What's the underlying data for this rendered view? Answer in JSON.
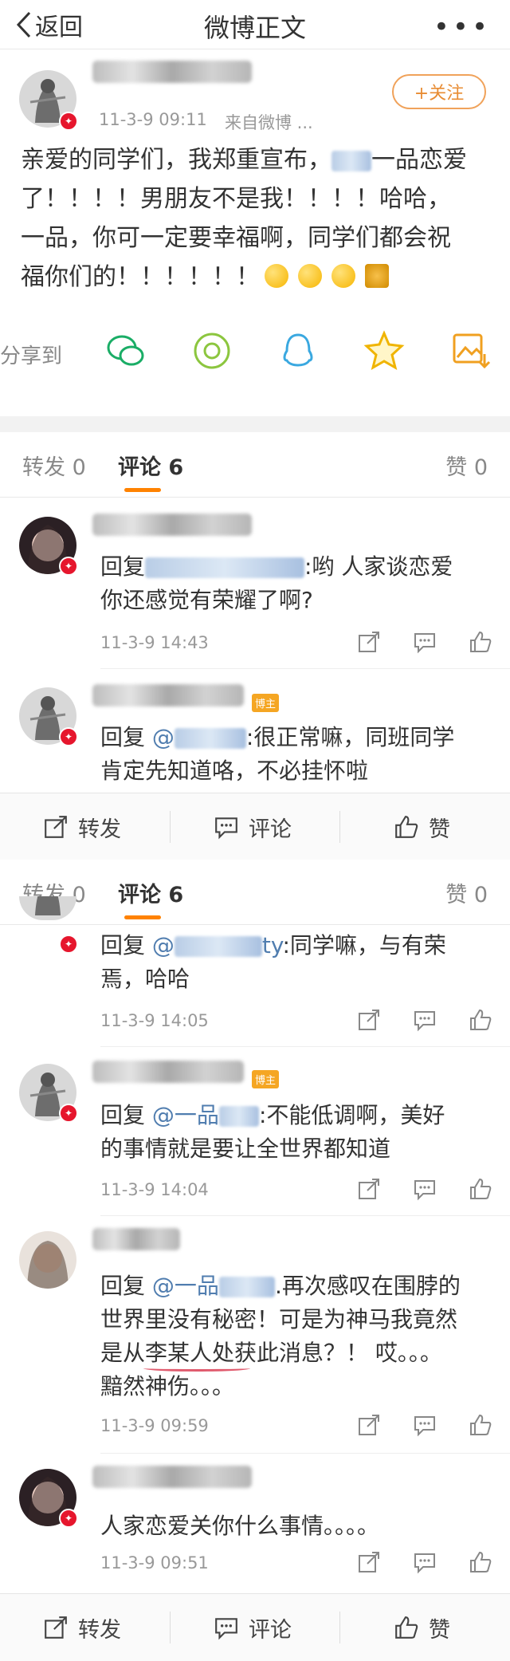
{
  "header": {
    "back_label": "返回",
    "title": "微博正文",
    "more": "•••"
  },
  "post": {
    "time": "11-3-9 09:11",
    "source": "来自微博 ...",
    "follow_label": "+关注",
    "text_lines": [
      "亲爱的同学们，我郑重宣布，",
      "一品恋爱",
      "了！！！！男朋友不是我！！！！哈哈，",
      "一品，你可一定要幸福啊，同学们都会祝",
      "福你们的！！！！！！"
    ]
  },
  "share": {
    "label": "分享到"
  },
  "tabs": {
    "repost": "转发 0",
    "comment": "评论 6",
    "like": "赞 0"
  },
  "actions": {
    "repost": "转发",
    "comment": "评论",
    "like": "赞"
  },
  "host_tag": "博主",
  "comments": [
    {
      "prefix": "回复",
      "text": ":哟 人家谈恋爱",
      "line2": "你还感觉有荣耀了啊?",
      "time": "11-3-9 14:43"
    },
    {
      "prefix": "回复",
      "mention": "@",
      "text": ":很正常嘛，同班同学",
      "line2": "肯定先知道咯，不必挂怀啦"
    },
    {
      "prefix": "回复",
      "mention": "@",
      "mention_tail": "ty",
      "text": ":同学嘛，与有荣",
      "line2": "焉，哈哈",
      "time": "11-3-9 14:05"
    },
    {
      "prefix": "回复",
      "mention": "@一品",
      "text": ":不能低调啊，美好",
      "line2": "的事情就是要让全世界都知道",
      "time": "11-3-9 14:04"
    },
    {
      "prefix": "回复",
      "mention": "@一品",
      "text": ".再次感叹在围脖的",
      "line2": "世界里没有秘密！可是为神马我竟然",
      "line3": "是从李某人处获此消息？！ 哎。。。",
      "line4": "黯然神伤。。。",
      "time": "11-3-9 09:59"
    },
    {
      "text": "人家恋爱关你什么事情。。。。",
      "time": "11-3-9 09:51"
    }
  ]
}
